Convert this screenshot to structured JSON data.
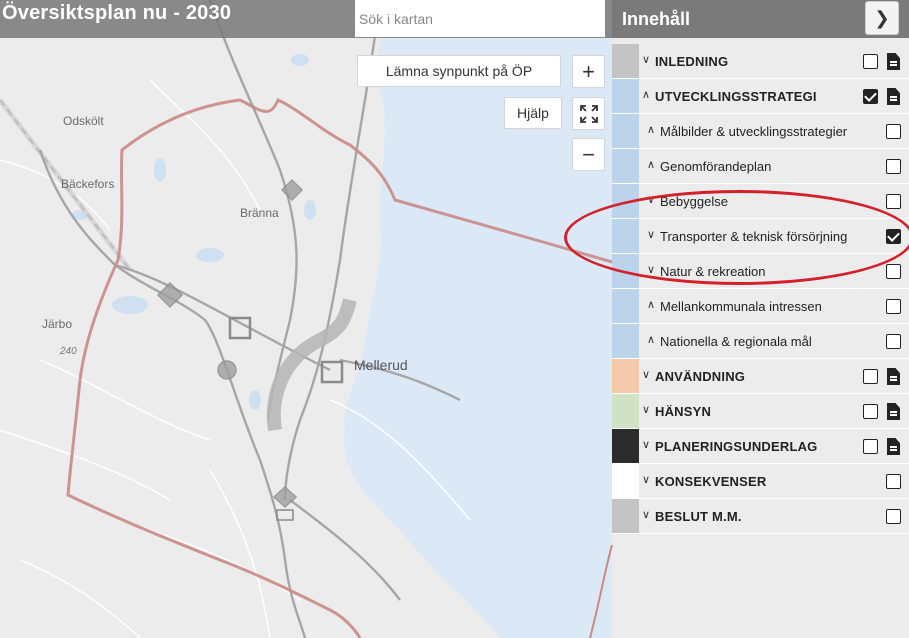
{
  "app": {
    "title": "Översiktsplan nu - 2030"
  },
  "search": {
    "placeholder": "Sök i kartan"
  },
  "map_controls": {
    "feedback_label": "Lämna synpunkt på ÖP",
    "help_label": "Hjälp",
    "zoom_in": "+",
    "zoom_out": "−",
    "fullscreen_icon": "fullscreen-icon"
  },
  "map": {
    "places": [
      {
        "id": "odskolt",
        "name": "Odskölt"
      },
      {
        "id": "backefors",
        "name": "Bäckefors"
      },
      {
        "id": "branna",
        "name": "Bränna"
      },
      {
        "id": "jarbo",
        "name": "Järbo"
      },
      {
        "id": "elev",
        "name": "240"
      },
      {
        "id": "mellerud",
        "name": "Mellerud"
      }
    ]
  },
  "panel": {
    "title": "Innehåll",
    "collapse_icon": "chevron-right-icon",
    "items": [
      {
        "label": "INLEDNING",
        "level": "main",
        "expanded": false,
        "checked": false,
        "doc": true,
        "color": "#c4c4c4"
      },
      {
        "label": "UTVECKLINGSSTRATEGI",
        "level": "main",
        "expanded": true,
        "checked": true,
        "doc": true,
        "color": "#bcd3ec"
      },
      {
        "label": "Målbilder & utvecklingsstrategier",
        "level": "sub",
        "expanded": true,
        "checked": false,
        "doc": false,
        "color": "#bcd3ec"
      },
      {
        "label": "Genomförandeplan",
        "level": "sub",
        "expanded": true,
        "checked": false,
        "doc": false,
        "color": "#bcd3ec"
      },
      {
        "label": "Bebyggelse",
        "level": "sub",
        "expanded": false,
        "checked": false,
        "doc": false,
        "color": "#bcd3ec"
      },
      {
        "label": "Transporter & teknisk försörjning",
        "level": "sub",
        "expanded": false,
        "checked": true,
        "doc": false,
        "color": "#bcd3ec"
      },
      {
        "label": "Natur & rekreation",
        "level": "sub",
        "expanded": false,
        "checked": false,
        "doc": false,
        "color": "#bcd3ec"
      },
      {
        "label": "Mellankommunala intressen",
        "level": "sub",
        "expanded": true,
        "checked": false,
        "doc": false,
        "color": "#bcd3ec"
      },
      {
        "label": "Nationella & regionala mål",
        "level": "sub",
        "expanded": true,
        "checked": false,
        "doc": false,
        "color": "#bcd3ec"
      },
      {
        "label": "ANVÄNDNING",
        "level": "main",
        "expanded": false,
        "checked": false,
        "doc": true,
        "color": "#f3c9ab"
      },
      {
        "label": "HÄNSYN",
        "level": "main",
        "expanded": false,
        "checked": false,
        "doc": true,
        "color": "#cfe2c3"
      },
      {
        "label": "PLANERINGSUNDERLAG",
        "level": "main",
        "expanded": false,
        "checked": false,
        "doc": true,
        "color": "#2b2b2b"
      },
      {
        "label": "KONSEKVENSER",
        "level": "main",
        "expanded": false,
        "checked": false,
        "doc": false,
        "color": "#ffffff"
      },
      {
        "label": "BESLUT M.M.",
        "level": "main",
        "expanded": false,
        "checked": false,
        "doc": false,
        "color": "#c4c4c4"
      }
    ]
  },
  "colors": {
    "highlight": "#d4202a",
    "water": "#dbe9f7",
    "boundary": "#c98a86",
    "topbar": "#7a7a7a"
  }
}
